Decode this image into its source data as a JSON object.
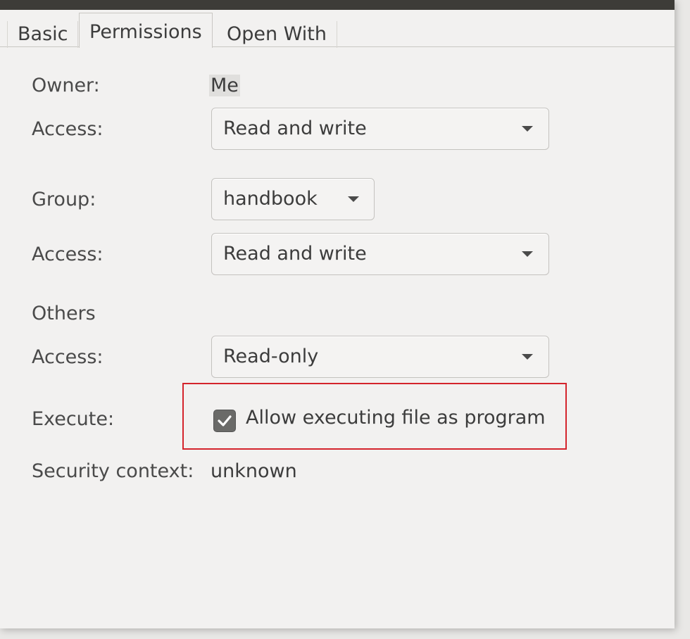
{
  "tabs": [
    {
      "label": "Basic"
    },
    {
      "label": "Permissions"
    },
    {
      "label": "Open With"
    }
  ],
  "owner": {
    "label": "Owner:",
    "value": "Me",
    "access_label": "Access:",
    "access_value": "Read and write"
  },
  "group": {
    "label": "Group:",
    "value": "handbook",
    "access_label": "Access:",
    "access_value": "Read and write"
  },
  "others": {
    "label": "Others",
    "access_label": "Access:",
    "access_value": "Read-only"
  },
  "execute": {
    "label": "Execute:",
    "checkbox_label": "Allow executing file as program",
    "checked": true
  },
  "security": {
    "label": "Security context:",
    "value": "unknown"
  },
  "colors": {
    "highlight": "#d4242c",
    "titlebar": "#3d3c38",
    "background": "#f2f1f0"
  }
}
